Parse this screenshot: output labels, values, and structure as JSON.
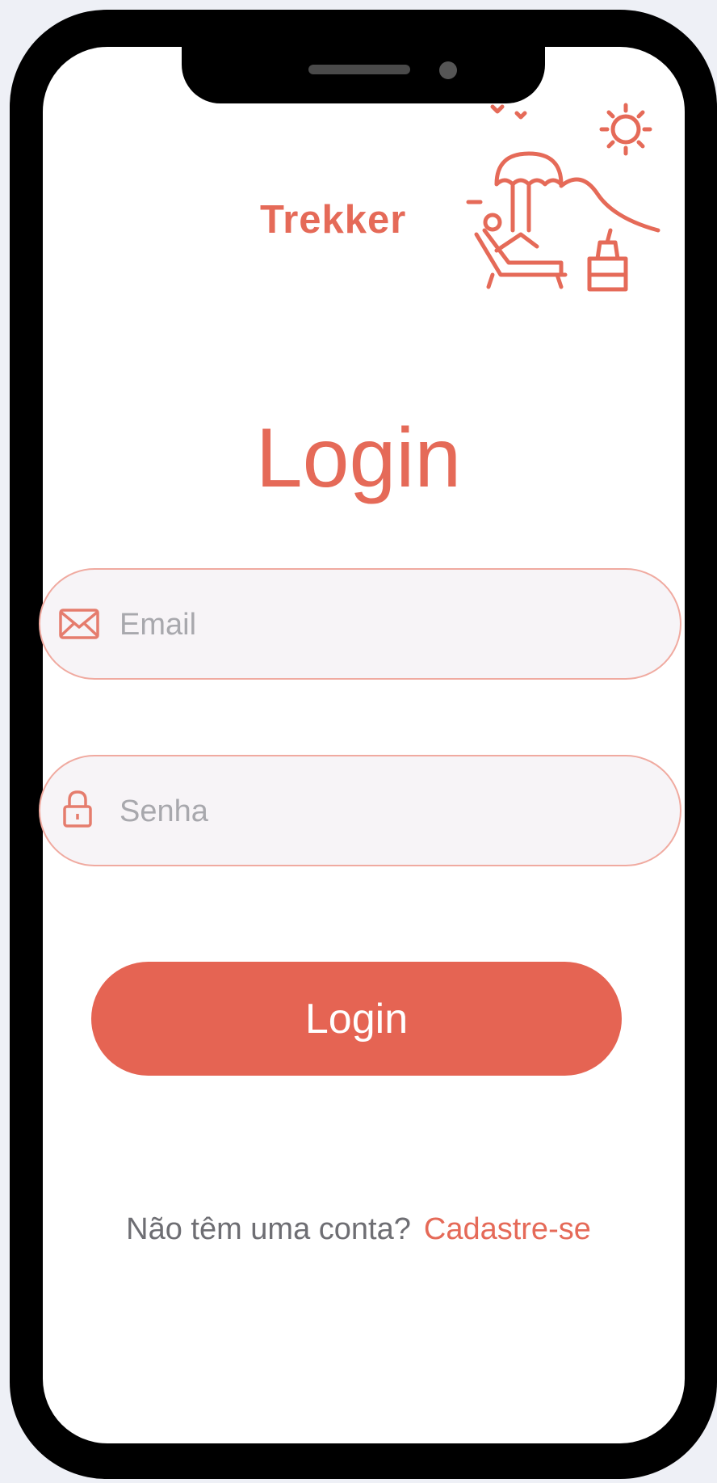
{
  "app": {
    "brand_name": "Trekker"
  },
  "login": {
    "title": "Login",
    "email": {
      "value": "",
      "placeholder": "Email",
      "icon": "envelope-icon"
    },
    "password": {
      "value": "",
      "placeholder": "Senha",
      "icon": "lock-icon"
    },
    "submit_label": "Login",
    "signup_prompt": "Não têm uma conta?",
    "signup_link": "Cadastre-se"
  },
  "illustration": {
    "icon": "beach-lounger-illustration"
  },
  "colors": {
    "accent": "#e56453",
    "field_bg": "#f7f4f7",
    "field_border": "#f0aaa0",
    "frame": "#000000"
  }
}
